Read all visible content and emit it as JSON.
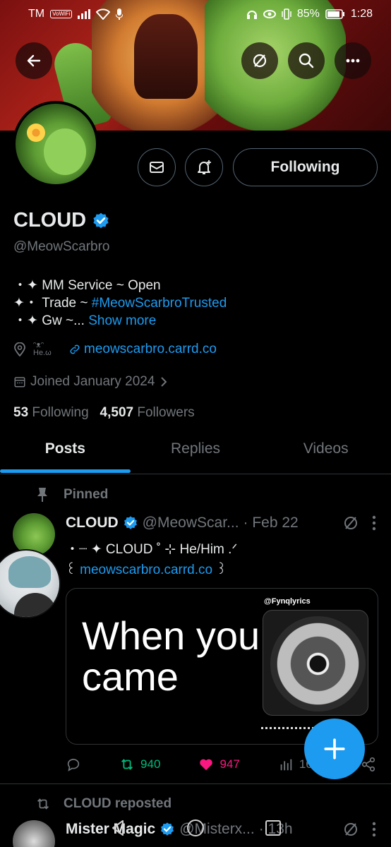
{
  "status_bar": {
    "carrier": "TM",
    "volte": "VoWiFi",
    "battery": "85%",
    "time": "1:28"
  },
  "profile": {
    "display_name": "CLOUD",
    "handle": "@MeowScarbro",
    "follow_button": "Following",
    "bio": {
      "line1": "・✦ MM Service ~ Open",
      "line2_prefix": "✦・ Trade ~ ",
      "line2_hashtag": "#MeowScarbroTrusted",
      "line3_prefix": "・✦ Gw ~...",
      "show_more": "Show more"
    },
    "location": "ᵔᴥᵔ He.ω",
    "website": "meowscarbro.carrd.co",
    "joined": "Joined January 2024",
    "following_count": "53",
    "following_label": "Following",
    "followers_count": "4,507",
    "followers_label": "Followers"
  },
  "tabs": [
    {
      "label": "Posts"
    },
    {
      "label": "Replies"
    },
    {
      "label": "Videos"
    }
  ],
  "pinned_post": {
    "pinned_label": "Pinned",
    "author": "CLOUD",
    "handle": "@MeowScar...",
    "date": "· Feb 22",
    "text_line1": "・┈ ✦ CLOUD ˚ ⊹ He/Him .ᐟ",
    "text_line2_prefix": "꒰ ",
    "text_line2_link": "meowscarbro.carrd.co",
    "text_line2_suffix": " ꒱",
    "media": {
      "credit": "@Fynqlyrics",
      "caption_line1": "When you",
      "caption_line2": "came"
    },
    "retweets": "940",
    "likes": "947",
    "views": "16.2"
  },
  "next_post": {
    "reposted_label": "CLOUD reposted",
    "author": "Mister Magic",
    "handle": "@Misterx...",
    "date": "· 13h"
  },
  "colors": {
    "accent": "#1d9bf0",
    "retweet": "#00ba7c",
    "like": "#f91880",
    "background": "#000000"
  }
}
